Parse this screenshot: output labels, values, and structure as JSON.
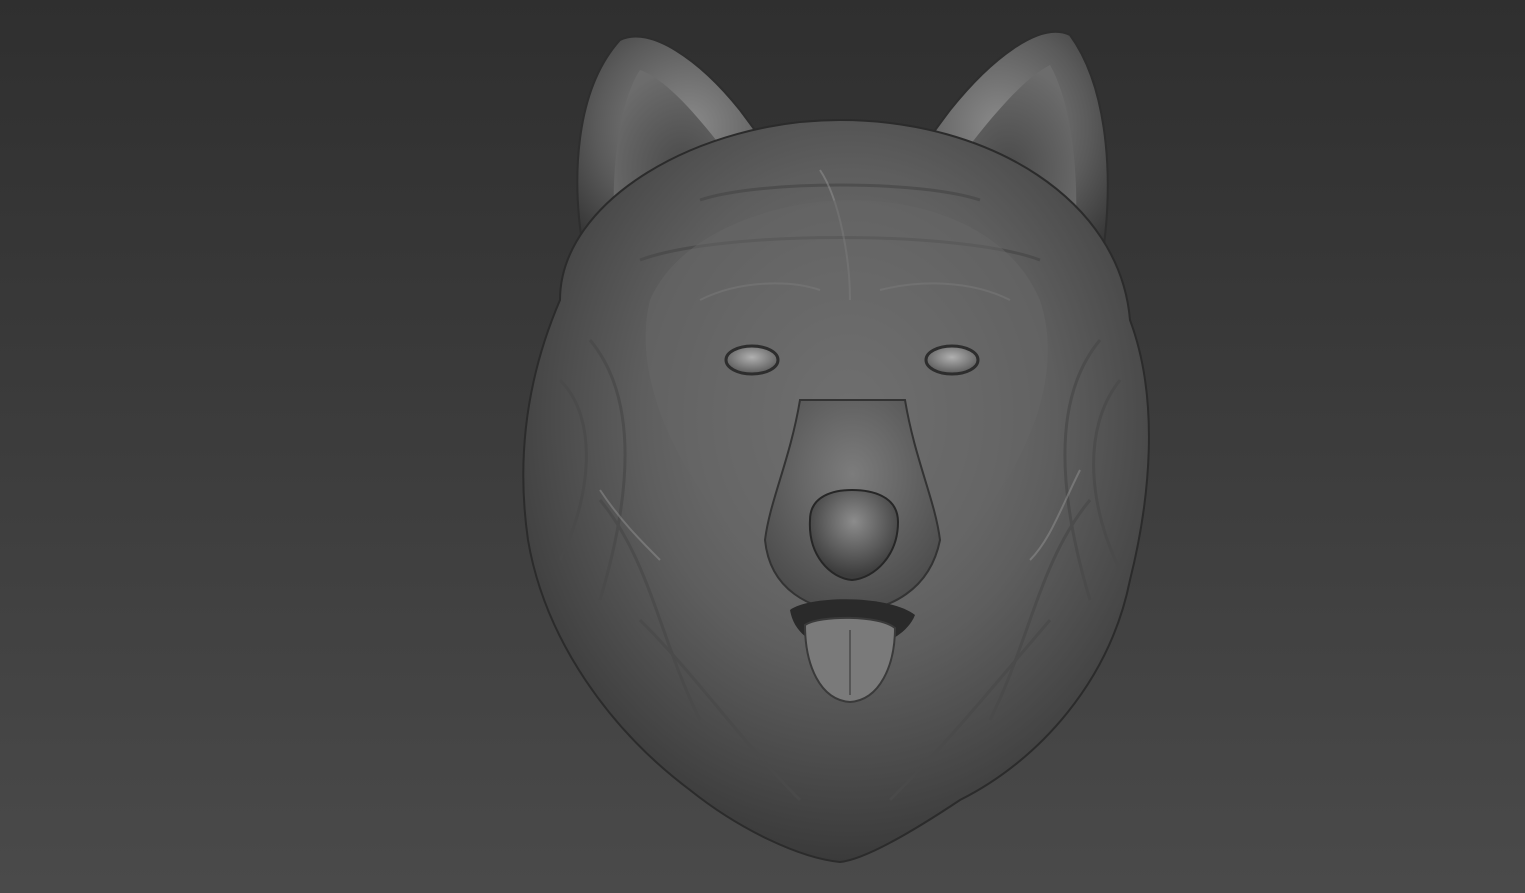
{
  "scene": {
    "background_top_color": "#2f2f2f",
    "background_bottom_color": "#4a4a4a",
    "subject": "wolf-head-sculpt",
    "material_color": "#6e6e6e",
    "highlight_color": "#a8a8a8",
    "shadow_color": "#2a2a2a"
  }
}
